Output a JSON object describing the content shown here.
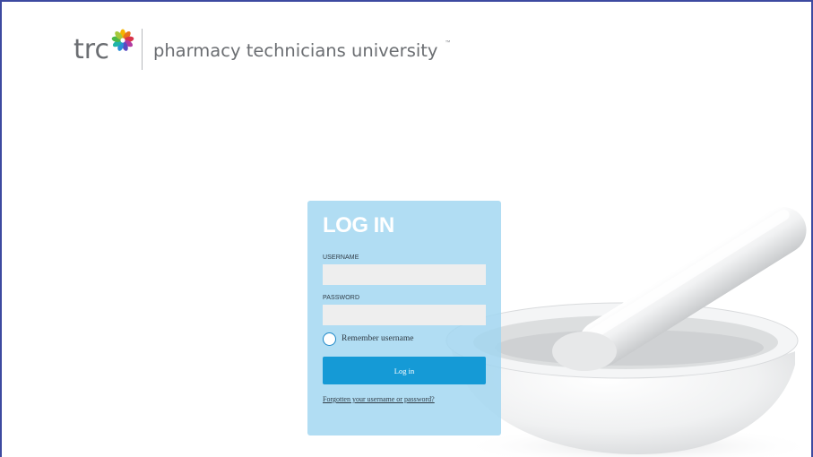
{
  "header": {
    "logo_text": "trc",
    "tagline": "pharmacy technicians university",
    "trademark": "™"
  },
  "icons": {
    "logo_mark": "multicolor-flower-icon",
    "radio": "radio-unchecked-icon",
    "hero": "mortar-and-pestle-illustration"
  },
  "login": {
    "title": "LOG IN",
    "username_label": "USERNAME",
    "username_value": "",
    "password_label": "PASSWORD",
    "password_value": "",
    "remember_label": "Remember username",
    "remember_checked": false,
    "button_label": "Log in",
    "forgot_link": "Forgotten your username or password?"
  },
  "colors": {
    "frame_border": "#3d4aa0",
    "card_background": "#a0d5f0",
    "button_background": "#159ad6",
    "text_gray": "#6b6e72"
  }
}
